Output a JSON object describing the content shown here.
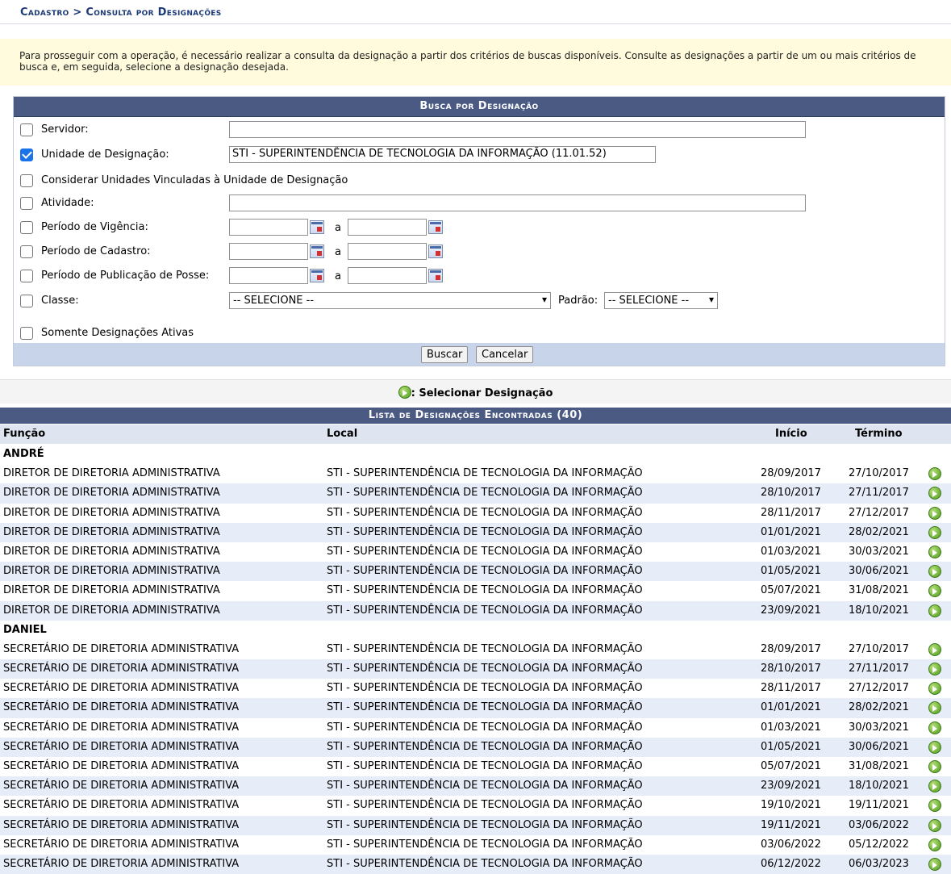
{
  "breadcrumb": "Cadastro > Consulta por Designações",
  "notice": "Para prosseguir com a operação, é necessário realizar a consulta da designação a partir dos critérios de buscas disponíveis. Consulte as designações a partir de um ou mais critérios de busca e, em seguida, selecione a designação desejada.",
  "search": {
    "title": "Busca por Designação",
    "servidor_label": "Servidor:",
    "servidor_value": "",
    "unidade_label": "Unidade de Designação:",
    "unidade_value": "STI - SUPERINTENDÊNCIA DE TECNOLOGIA DA INFORMAÇÃO (11.01.52)",
    "unidade_checked": true,
    "vinculadas_label": "Considerar Unidades Vinculadas à Unidade de Designação",
    "atividade_label": "Atividade:",
    "vigencia_label": "Período de Vigência:",
    "cadastro_label": "Período de Cadastro:",
    "posse_label": "Período de Publicação de Posse:",
    "range_sep": "a",
    "classe_label": "Classe:",
    "classe_selected": "-- SELECIONE --",
    "padrao_label": "Padrão:",
    "padrao_selected": "-- SELECIONE --",
    "ativas_label": "Somente Designações Ativas",
    "buscar": "Buscar",
    "cancelar": "Cancelar"
  },
  "legend": ": Selecionar Designação",
  "list": {
    "title": "Lista de Designações Encontradas (40)",
    "headers": {
      "funcao": "Função",
      "local": "Local",
      "inicio": "Início",
      "termino": "Término"
    },
    "groups": [
      {
        "name": "ANDRÉ",
        "rows": [
          {
            "funcao": "DIRETOR DE DIRETORIA ADMINISTRATIVA",
            "local": "STI - SUPERINTENDÊNCIA DE TECNOLOGIA DA INFORMAÇÃO",
            "inicio": "28/09/2017",
            "termino": "27/10/2017"
          },
          {
            "funcao": "DIRETOR DE DIRETORIA ADMINISTRATIVA",
            "local": "STI - SUPERINTENDÊNCIA DE TECNOLOGIA DA INFORMAÇÃO",
            "inicio": "28/10/2017",
            "termino": "27/11/2017"
          },
          {
            "funcao": "DIRETOR DE DIRETORIA ADMINISTRATIVA",
            "local": "STI - SUPERINTENDÊNCIA DE TECNOLOGIA DA INFORMAÇÃO",
            "inicio": "28/11/2017",
            "termino": "27/12/2017"
          },
          {
            "funcao": "DIRETOR DE DIRETORIA ADMINISTRATIVA",
            "local": "STI - SUPERINTENDÊNCIA DE TECNOLOGIA DA INFORMAÇÃO",
            "inicio": "01/01/2021",
            "termino": "28/02/2021"
          },
          {
            "funcao": "DIRETOR DE DIRETORIA ADMINISTRATIVA",
            "local": "STI - SUPERINTENDÊNCIA DE TECNOLOGIA DA INFORMAÇÃO",
            "inicio": "01/03/2021",
            "termino": "30/03/2021"
          },
          {
            "funcao": "DIRETOR DE DIRETORIA ADMINISTRATIVA",
            "local": "STI - SUPERINTENDÊNCIA DE TECNOLOGIA DA INFORMAÇÃO",
            "inicio": "01/05/2021",
            "termino": "30/06/2021"
          },
          {
            "funcao": "DIRETOR DE DIRETORIA ADMINISTRATIVA",
            "local": "STI - SUPERINTENDÊNCIA DE TECNOLOGIA DA INFORMAÇÃO",
            "inicio": "05/07/2021",
            "termino": "31/08/2021"
          },
          {
            "funcao": "DIRETOR DE DIRETORIA ADMINISTRATIVA",
            "local": "STI - SUPERINTENDÊNCIA DE TECNOLOGIA DA INFORMAÇÃO",
            "inicio": "23/09/2021",
            "termino": "18/10/2021"
          }
        ]
      },
      {
        "name": "DANIEL",
        "rows": [
          {
            "funcao": "SECRETÁRIO DE DIRETORIA ADMINISTRATIVA",
            "local": "STI - SUPERINTENDÊNCIA DE TECNOLOGIA DA INFORMAÇÃO",
            "inicio": "28/09/2017",
            "termino": "27/10/2017"
          },
          {
            "funcao": "SECRETÁRIO DE DIRETORIA ADMINISTRATIVA",
            "local": "STI - SUPERINTENDÊNCIA DE TECNOLOGIA DA INFORMAÇÃO",
            "inicio": "28/10/2017",
            "termino": "27/11/2017"
          },
          {
            "funcao": "SECRETÁRIO DE DIRETORIA ADMINISTRATIVA",
            "local": "STI - SUPERINTENDÊNCIA DE TECNOLOGIA DA INFORMAÇÃO",
            "inicio": "28/11/2017",
            "termino": "27/12/2017"
          },
          {
            "funcao": "SECRETÁRIO DE DIRETORIA ADMINISTRATIVA",
            "local": "STI - SUPERINTENDÊNCIA DE TECNOLOGIA DA INFORMAÇÃO",
            "inicio": "01/01/2021",
            "termino": "28/02/2021"
          },
          {
            "funcao": "SECRETÁRIO DE DIRETORIA ADMINISTRATIVA",
            "local": "STI - SUPERINTENDÊNCIA DE TECNOLOGIA DA INFORMAÇÃO",
            "inicio": "01/03/2021",
            "termino": "30/03/2021"
          },
          {
            "funcao": "SECRETÁRIO DE DIRETORIA ADMINISTRATIVA",
            "local": "STI - SUPERINTENDÊNCIA DE TECNOLOGIA DA INFORMAÇÃO",
            "inicio": "01/05/2021",
            "termino": "30/06/2021"
          },
          {
            "funcao": "SECRETÁRIO DE DIRETORIA ADMINISTRATIVA",
            "local": "STI - SUPERINTENDÊNCIA DE TECNOLOGIA DA INFORMAÇÃO",
            "inicio": "05/07/2021",
            "termino": "31/08/2021"
          },
          {
            "funcao": "SECRETÁRIO DE DIRETORIA ADMINISTRATIVA",
            "local": "STI - SUPERINTENDÊNCIA DE TECNOLOGIA DA INFORMAÇÃO",
            "inicio": "23/09/2021",
            "termino": "18/10/2021"
          },
          {
            "funcao": "SECRETÁRIO DE DIRETORIA ADMINISTRATIVA",
            "local": "STI - SUPERINTENDÊNCIA DE TECNOLOGIA DA INFORMAÇÃO",
            "inicio": "19/10/2021",
            "termino": "19/11/2021"
          },
          {
            "funcao": "SECRETÁRIO DE DIRETORIA ADMINISTRATIVA",
            "local": "STI - SUPERINTENDÊNCIA DE TECNOLOGIA DA INFORMAÇÃO",
            "inicio": "19/11/2021",
            "termino": "03/06/2022"
          },
          {
            "funcao": "SECRETÁRIO DE DIRETORIA ADMINISTRATIVA",
            "local": "STI - SUPERINTENDÊNCIA DE TECNOLOGIA DA INFORMAÇÃO",
            "inicio": "03/06/2022",
            "termino": "05/12/2022"
          },
          {
            "funcao": "SECRETÁRIO DE DIRETORIA ADMINISTRATIVA",
            "local": "STI - SUPERINTENDÊNCIA DE TECNOLOGIA DA INFORMAÇÃO",
            "inicio": "06/12/2022",
            "termino": "06/03/2023"
          }
        ]
      }
    ]
  }
}
